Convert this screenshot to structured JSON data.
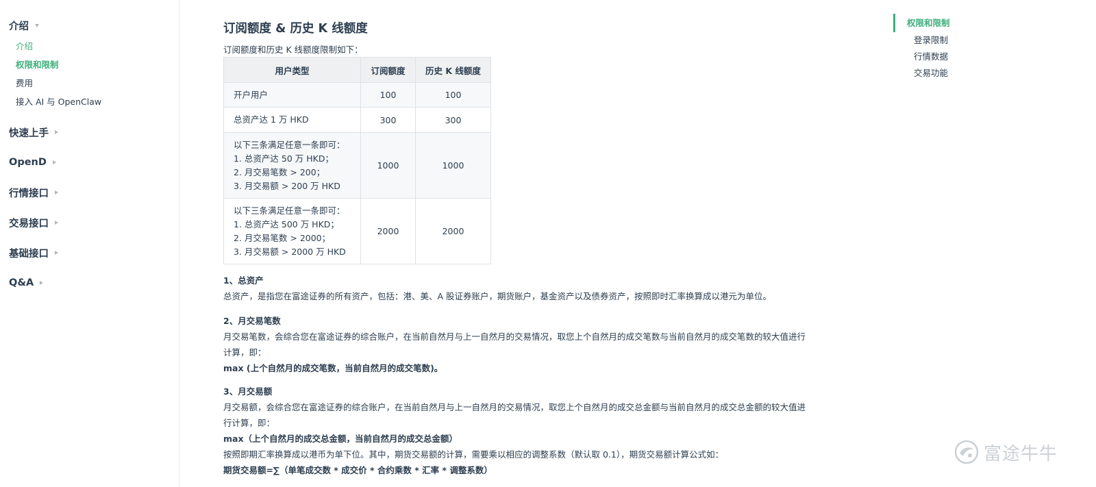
{
  "sidebar": {
    "intro": {
      "title": "介绍",
      "items": [
        "介绍",
        "权限和限制",
        "费用",
        "接入 AI 与 OpenClaw"
      ]
    },
    "groups": [
      "快速上手",
      "OpenD",
      "行情接口",
      "交易接口",
      "基础接口",
      "Q&A"
    ]
  },
  "content": {
    "heading": "订阅额度 & 历史 K 线额度",
    "intro": "订阅额度和历史 K 线额度限制如下：",
    "table": {
      "headers": [
        "用户类型",
        "订阅额度",
        "历史 K 线额度"
      ],
      "rows": [
        {
          "type": [
            "开户用户"
          ],
          "sub": "100",
          "kline": "100"
        },
        {
          "type": [
            "总资产达 1 万 HKD"
          ],
          "sub": "300",
          "kline": "300"
        },
        {
          "type": [
            "以下三条满足任意一条即可：",
            "1. 总资产达 50 万 HKD；",
            "2. 月交易笔数 > 200；",
            "3. 月交易额 > 200 万 HKD"
          ],
          "sub": "1000",
          "kline": "1000"
        },
        {
          "type": [
            "以下三条满足任意一条即可：",
            "1. 总资产达 500 万 HKD；",
            "2. 月交易笔数 > 2000；",
            "3. 月交易额 > 2000 万 HKD"
          ],
          "sub": "2000",
          "kline": "2000"
        }
      ]
    },
    "s1": {
      "title": "1、总资产",
      "body": "总资产，是指您在富途证券的所有资产，包括：港、美、A 股证券账户，期货账户，基金资产以及债券资产，按照即时汇率换算成以港元为单位。"
    },
    "s2": {
      "title": "2、月交易笔数",
      "body1": "月交易笔数，会综合您在富途证券的综合账户，在当前自然月与上一自然月的交易情况，取您上个自然月的成交笔数与当前自然月的成交笔数的较大值进行",
      "body2": "计算，即：",
      "formula": "max (上个自然月的成交笔数，当前自然月的成交笔数)。"
    },
    "s3": {
      "title": "3、月交易额",
      "body1": "月交易额，会综合您在富途证券的综合账户，在当前自然月与上一自然月的交易情况，取您上个自然月的成交总金额与当前自然月的成交总金额的较大值进",
      "body2": "行计算，即：",
      "formula": "max（上个自然月的成交总金额，当前自然月的成交总金额）",
      "body3": "按照即期汇率换算成以港币为单下位。其中，期货交易额的计算，需要乘以相应的调整系数（默认取 0.1），期货交易额计算公式如：",
      "formula2": "期货交易额=∑（单笔成交数 * 成交价 * 合约乘数 * 汇率 * 调整系数）"
    }
  },
  "toc": {
    "items": [
      "权限和限制",
      "登录限制",
      "行情数据",
      "交易功能"
    ]
  },
  "watermark": {
    "text": "富途牛牛"
  },
  "colors": {
    "accent": "#3eaf7c",
    "text": "#2c3e50",
    "border": "#dfe2e5"
  }
}
